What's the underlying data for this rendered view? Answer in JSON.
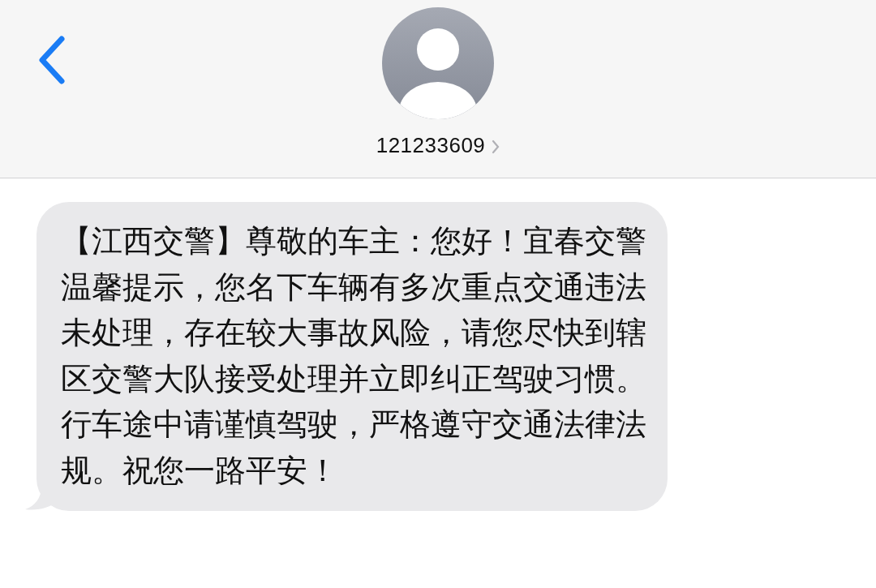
{
  "header": {
    "contact": "121233609"
  },
  "messages": [
    {
      "kind": "incoming",
      "text": "【江西交警】尊敬的车主：您好！宜春交警温馨提示，您名下车辆有多次重点交通违法未处理，存在较大事故风险，请您尽快到辖区交警大队接受处理并立即纠正驾驶习惯。行车途中请谨慎驾驶，严格遵守交通法律法规。祝您一路平安！"
    }
  ]
}
